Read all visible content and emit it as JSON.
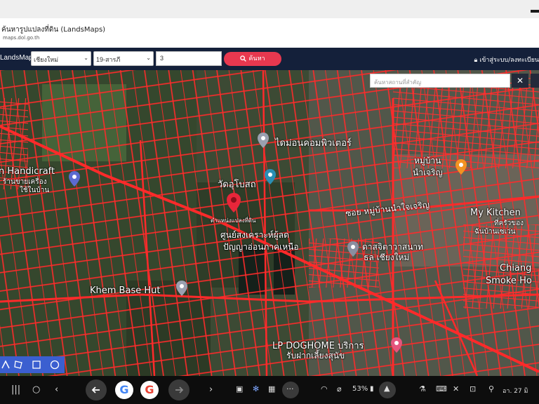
{
  "browser": {
    "page_title": "ค้นหารูปแปลงที่ดิน (LandsMaps)",
    "page_url": "maps.dol.go.th"
  },
  "navbar": {
    "brand": "LandsMaps",
    "province": "เชียงใหม่",
    "district": "19-สารภี",
    "parcel_value": "3",
    "search_label": "ค้นหา",
    "login_label": "เข้าสู่ระบบ/ลงทะเบียน"
  },
  "map": {
    "search_placeholder": "ค้นหาสถานที่สำคัญ",
    "close_label": "✕",
    "labels": {
      "diamond_computer": "ไดม่อนคอมพิวเตอร์",
      "handicraft": "n Handicraft",
      "handicraft_th": "ร้านขายเครื่อง",
      "handicraft_th2": "ใช้ในบ้าน",
      "wat": "วัดอุโบสถ",
      "parcel_pin": "ตำแหน่งแปลงที่ดิน",
      "center": "ศูนย์สงเคราะห์ผู้ลด",
      "center2": "ปัญญาอ่อนภาคเหนือ",
      "soi": "ซอย หมู่บ้านนำใจเจริญ",
      "nambin": "หมู่บ้าน",
      "nambin2": "นำเจริญ",
      "dorm": "ดาสจิตาวาสนาท",
      "dorm2": "ธล เชียงใหม่",
      "mykitchen": "My Kitchen",
      "mykitchen_th": "ที่ครัวของ",
      "mykitchen_th2": "ฉันบ้านเซเว่น",
      "chiang": "Chiang",
      "smoke": "Smoke Ho",
      "khem": "Khem Base Hut",
      "lp": "LP DOGHOME บริการ",
      "lp2": "รับฝากเลี้ยงสุนัข"
    }
  },
  "taskbar": {
    "battery": "53%",
    "datetime": "อา. 27 มิ"
  },
  "colors": {
    "navbar": "#14203a",
    "accent_red": "#e8384f",
    "parcel_lines": "#ff2020"
  }
}
